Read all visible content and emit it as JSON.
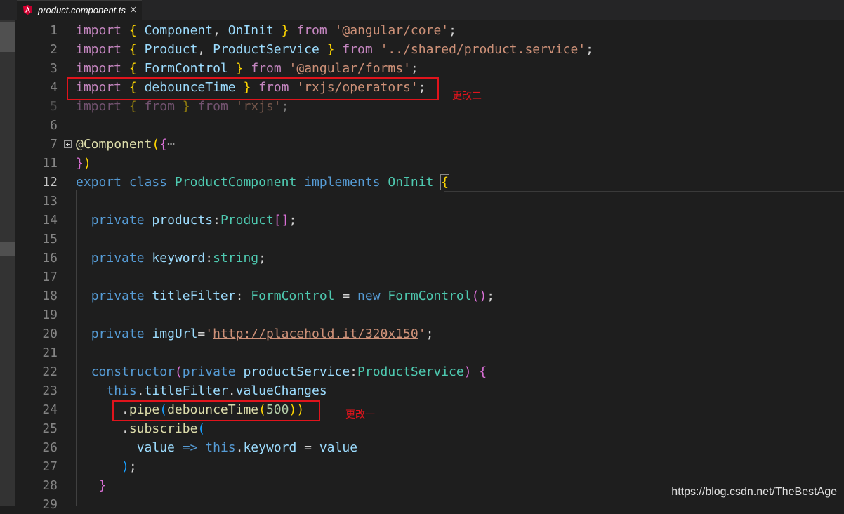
{
  "tab": {
    "icon": "angular-icon",
    "title": "product.component.ts",
    "close": "×"
  },
  "colors": {
    "keyword": "#569cd6",
    "control": "#c586c0",
    "string": "#ce9178",
    "type": "#4ec9b0",
    "variable": "#9cdcfe",
    "function": "#dcdcaa",
    "number": "#b5cea8",
    "annotation": "#e0141c"
  },
  "lines": [
    {
      "n": "1",
      "t": [
        "import",
        " ",
        "{",
        " ",
        "Component",
        ", ",
        "OnInit",
        " ",
        "}",
        " ",
        "from",
        " ",
        "'@angular/core'",
        ";"
      ]
    },
    {
      "n": "2",
      "t": [
        "import",
        " ",
        "{",
        " ",
        "Product",
        ", ",
        "ProductService",
        " ",
        "}",
        " ",
        "from",
        " ",
        "'../shared/product.service'",
        ";"
      ]
    },
    {
      "n": "3",
      "t": [
        "import",
        " ",
        "{",
        " ",
        "FormControl",
        " ",
        "}",
        " ",
        "from",
        " ",
        "'@angular/forms'",
        ";"
      ]
    },
    {
      "n": "4",
      "t": [
        "import",
        " ",
        "{",
        " ",
        "debounceTime",
        " ",
        "}",
        " ",
        "from",
        " ",
        "'rxjs/operators'",
        ";"
      ]
    },
    {
      "n": "5",
      "t": [
        "import",
        " ",
        "{",
        " ",
        "from",
        " ",
        "}",
        " ",
        "from",
        " ",
        "'rxjs'",
        ";"
      ]
    },
    {
      "n": "6",
      "t": []
    },
    {
      "n": "7",
      "t": [
        "@",
        "Component",
        "(",
        "{",
        "⋯"
      ]
    },
    {
      "n": "11",
      "t": [
        "}",
        ")"
      ]
    },
    {
      "n": "12",
      "t": [
        "export",
        " ",
        "class",
        " ",
        "ProductComponent",
        " ",
        "implements",
        " ",
        "OnInit",
        " ",
        "{"
      ]
    },
    {
      "n": "13",
      "t": []
    },
    {
      "n": "14",
      "t": [
        "  ",
        "private",
        " ",
        "products",
        ":",
        "Product",
        "[]",
        ";"
      ]
    },
    {
      "n": "15",
      "t": []
    },
    {
      "n": "16",
      "t": [
        "  ",
        "private",
        " ",
        "keyword",
        ":",
        "string",
        ";"
      ]
    },
    {
      "n": "17",
      "t": []
    },
    {
      "n": "18",
      "t": [
        "  ",
        "private",
        " ",
        "titleFilter",
        ": ",
        "FormControl",
        " = ",
        "new",
        " ",
        "FormControl",
        "()",
        ";"
      ]
    },
    {
      "n": "19",
      "t": []
    },
    {
      "n": "20",
      "t": [
        "  ",
        "private",
        " ",
        "imgUrl",
        "=",
        "'",
        "http://placehold.it/320x150",
        "'",
        ";"
      ]
    },
    {
      "n": "21",
      "t": []
    },
    {
      "n": "22",
      "t": [
        "  ",
        "constructor",
        "(",
        "private",
        " ",
        "productService",
        ":",
        "ProductService",
        ")",
        " ",
        "{"
      ]
    },
    {
      "n": "23",
      "t": [
        "    ",
        "this",
        ".",
        "titleFilter",
        ".",
        "valueChanges"
      ]
    },
    {
      "n": "24",
      "t": [
        "      ",
        ".",
        "pipe",
        "(",
        "debounceTime",
        "(",
        "500",
        "))"
      ]
    },
    {
      "n": "25",
      "t": [
        "      ",
        ".",
        "subscribe",
        "("
      ]
    },
    {
      "n": "26",
      "t": [
        "        ",
        "value",
        " ",
        "=>",
        " ",
        "this",
        ".",
        "keyword",
        " = ",
        "value"
      ]
    },
    {
      "n": "27",
      "t": [
        "      ",
        ")",
        ";"
      ]
    },
    {
      "n": "28",
      "t": [
        "   ",
        "}"
      ]
    },
    {
      "n": "29",
      "t": []
    }
  ],
  "annotations": {
    "change2": "更改二",
    "change1": "更改一"
  },
  "watermark": "https://blog.csdn.net/TheBestAge"
}
